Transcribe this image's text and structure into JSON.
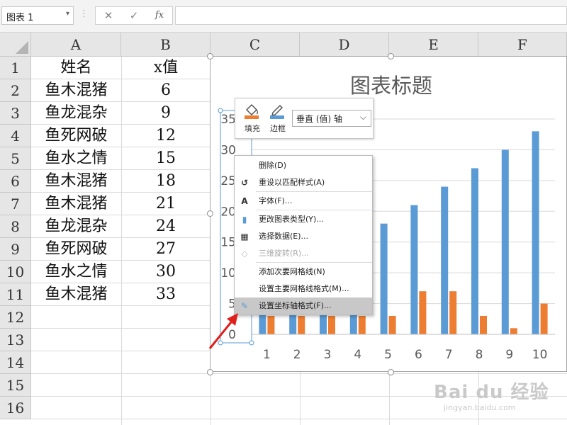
{
  "formula_bar": {
    "name_box": "图表 1",
    "separator": "⋮",
    "cancel_glyph": "✕",
    "enter_glyph": "✓",
    "fx_label": "fx",
    "formula": ""
  },
  "columns": [
    "A",
    "B",
    "C",
    "D",
    "E",
    "F"
  ],
  "rows": [
    "1",
    "2",
    "3",
    "4",
    "5",
    "6",
    "7",
    "8",
    "9",
    "10",
    "11",
    "12",
    "13",
    "14",
    "15",
    "16"
  ],
  "table": {
    "headers": [
      "姓名",
      "x值"
    ],
    "rows": [
      [
        "鱼木混猪",
        "6"
      ],
      [
        "鱼龙混杂",
        "9"
      ],
      [
        "鱼死网破",
        "12"
      ],
      [
        "鱼水之情",
        "15"
      ],
      [
        "鱼木混猪",
        "18"
      ],
      [
        "鱼木混猪",
        "21"
      ],
      [
        "鱼龙混杂",
        "24"
      ],
      [
        "鱼死网破",
        "27"
      ],
      [
        "鱼水之情",
        "30"
      ],
      [
        "鱼木混猪",
        "33"
      ]
    ]
  },
  "chart_data": {
    "type": "bar",
    "title": "图表标题",
    "categories": [
      "1",
      "2",
      "3",
      "4",
      "5",
      "6",
      "7",
      "8",
      "9",
      "10"
    ],
    "ylim": [
      0,
      35
    ],
    "yticks": [
      0,
      5,
      10,
      15,
      20,
      25,
      30,
      35
    ],
    "grid": true,
    "series": [
      {
        "values": [
          6,
          9,
          12,
          15,
          18,
          21,
          24,
          27,
          30,
          33
        ],
        "color": "#5b9bd5"
      },
      {
        "values": [
          3,
          3,
          3,
          3,
          3,
          7,
          7,
          3,
          1,
          5
        ],
        "color": "#ed7d31"
      }
    ]
  },
  "mini_toolbar": {
    "fill_label": "填充",
    "border_label": "边框",
    "element_select": "垂直 (值) 轴",
    "fill_color": "#ed7d31",
    "border_color": "#5b9bd5"
  },
  "context_menu": {
    "items": [
      {
        "label": "删除(D)",
        "icon": "",
        "disabled": false
      },
      {
        "label": "重设以匹配样式(A)",
        "icon": "reset-style-icon",
        "disabled": false
      },
      {
        "label": "字体(F)...",
        "icon": "font-icon",
        "disabled": false
      },
      {
        "label": "更改图表类型(Y)...",
        "icon": "chart-type-icon",
        "disabled": false
      },
      {
        "label": "选择数据(E)...",
        "icon": "select-data-icon",
        "disabled": false
      },
      {
        "label": "三维旋转(R)...",
        "icon": "3d-rotation-icon",
        "disabled": true
      },
      {
        "label": "添加次要网格线(N)",
        "icon": "",
        "disabled": false
      },
      {
        "label": "设置主要网格线格式(M)...",
        "icon": "",
        "disabled": false
      },
      {
        "label": "设置坐标轴格式(F)...",
        "icon": "format-axis-icon",
        "disabled": false,
        "highlighted": true
      }
    ]
  },
  "annotation": {
    "arrow_color": "#e0201c"
  },
  "watermark": {
    "brand": "Bai du 经验",
    "url": "jingyan.baidu.com"
  }
}
